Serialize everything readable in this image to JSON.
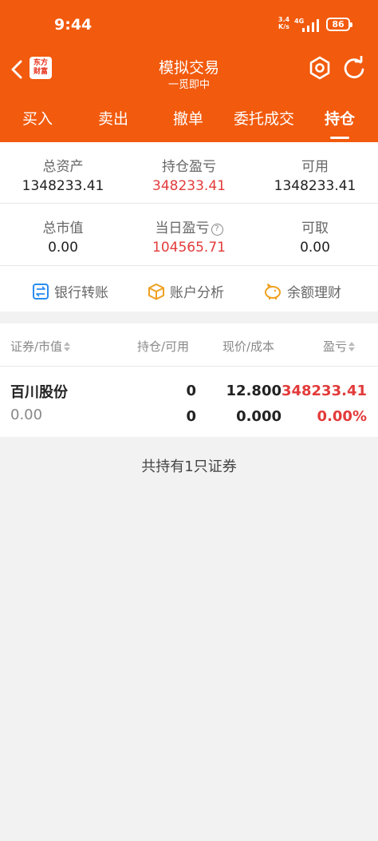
{
  "status_bar": {
    "time": "9:44",
    "net_speed_top": "3.4",
    "net_speed_bottom": "K/s",
    "network": "4G",
    "battery": "86"
  },
  "header": {
    "logo_line1": "东方",
    "logo_line2": "财富",
    "title": "模拟交易",
    "subtitle": "一觅即中",
    "background_color": "#f25a0d"
  },
  "tabs": [
    {
      "label": "买入"
    },
    {
      "label": "卖出"
    },
    {
      "label": "撤单"
    },
    {
      "label": "委托成交"
    },
    {
      "label": "持仓",
      "active": true
    }
  ],
  "summary": {
    "total_assets_label": "总资产",
    "total_assets_value": "1348233.41",
    "position_pl_label": "持仓盈亏",
    "position_pl_value": "348233.41",
    "available_label": "可用",
    "available_value": "1348233.41",
    "market_value_label": "总市值",
    "market_value_value": "0.00",
    "daily_pl_label": "当日盈亏",
    "daily_pl_value": "104565.71",
    "withdrawable_label": "可取",
    "withdrawable_value": "0.00"
  },
  "actions": {
    "bank_transfer": "银行转账",
    "account_analysis": "账户分析",
    "balance_finance": "余额理财"
  },
  "table": {
    "headers": {
      "security": "证券/市值",
      "holding": "持仓/可用",
      "price": "现价/成本",
      "pl": "盈亏"
    },
    "rows": [
      {
        "name": "百川股份",
        "market_value": "0.00",
        "holding": "0",
        "available": "0",
        "price": "12.800",
        "cost": "0.000",
        "pl": "348233.41",
        "pl_pct": "0.00%"
      }
    ]
  },
  "footer_note": "共持有1只证券",
  "colors": {
    "accent": "#f25a0d",
    "gain": "#e33b3b"
  }
}
